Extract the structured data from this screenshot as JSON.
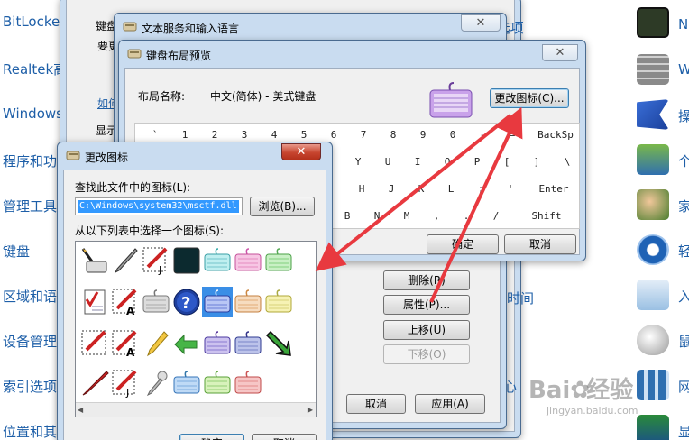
{
  "control_panel_left": [
    "BitLocke",
    "Realtek高",
    "Windows",
    "程序和功",
    "管理工具",
    "键盘",
    "区域和语",
    "设备管理",
    "索引选项",
    "位置和其"
  ],
  "control_panel_right": [
    "N",
    "W",
    "操",
    "个",
    "家",
    "轻",
    "入",
    "鼠",
    "网",
    "显"
  ],
  "bg_dialog": {
    "left_text": [
      "键盘",
      "要更",
      "如何",
      "显示"
    ],
    "blue_link": "如何",
    "partial_title": "t 选项",
    "delete_button": "删除(R)",
    "properties_button": "属性(P)...",
    "move_up_button": "上移(U)",
    "move_down_button": "下移(O)",
    "time_text": "时间",
    "heart_text": "心",
    "cancel_button": "取消",
    "apply_button": "应用(A)"
  },
  "text_services_window": {
    "title": "文本服务和输入语言",
    "close": "✕"
  },
  "preview_window": {
    "title": "键盘布局预览",
    "layout_label": "布局名称:",
    "layout_value": "中文(简体) - 美式键盘",
    "change_icon_button": "更改图标(C)...",
    "ok_button": "确定",
    "cancel_button": "取消",
    "keys_row1": [
      "`",
      "1",
      "2",
      "3",
      "4",
      "5",
      "6",
      "7",
      "8",
      "9",
      "0",
      "-",
      "=",
      "BackSp"
    ],
    "keys_row2": [
      "Y",
      "U",
      "I",
      "O",
      "P",
      "[",
      "]",
      "\\"
    ],
    "keys_row3": [
      "H",
      "J",
      "K",
      "L",
      ";",
      "'",
      "Enter"
    ],
    "keys_row4": [
      "B",
      "N",
      "M",
      ",",
      ".",
      "/",
      "Shift"
    ],
    "close": "✕"
  },
  "change_icon_window": {
    "title": "更改图标",
    "find_label": "查找此文件中的图标(L):",
    "path_value": "C:\\Windows\\system32\\msctf.dll",
    "browse_button": "浏览(B)...",
    "select_label": "从以下列表中选择一个图标(S):",
    "ok_button": "确定",
    "cancel_button": "取消",
    "close": "✕"
  },
  "watermark": {
    "brand": "Bai",
    "brand2": "经验",
    "url": "jingyan.baidu.com"
  },
  "colors": {
    "link": "#1e5fa8",
    "arrow": "#e8393f",
    "selection": "#3a8ee6",
    "keyboard_purple": "#b07ad6"
  }
}
